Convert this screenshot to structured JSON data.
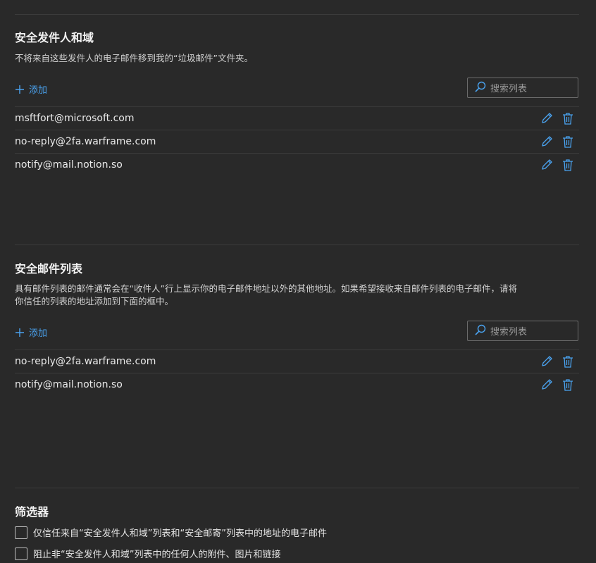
{
  "safe_senders": {
    "title": "安全发件人和域",
    "description": "不将来自这些发件人的电子邮件移到我的“垃圾邮件”文件夹。",
    "add_label": "添加",
    "search_placeholder": "搜索列表",
    "items": [
      "msftfort@microsoft.com",
      "no-reply@2fa.warframe.com",
      "notify@mail.notion.so"
    ]
  },
  "safe_mailing_lists": {
    "title": "安全邮件列表",
    "description_line1": "具有邮件列表的邮件通常会在“收件人”行上显示你的电子邮件地址以外的其他地址。如果希望接收来自邮件列表的电子邮件，请将",
    "description_line2": "你信任的列表的地址添加到下面的框中。",
    "add_label": "添加",
    "search_placeholder": "搜索列表",
    "items": [
      "no-reply@2fa.warframe.com",
      "notify@mail.notion.so"
    ]
  },
  "filters": {
    "title": "筛选器",
    "options": [
      {
        "label": "仅信任来自“安全发件人和域”列表和“安全邮寄”列表中的地址的电子邮件",
        "checked": false
      },
      {
        "label": "阻止非“安全发件人和域”列表中的任何人的附件、图片和链接",
        "checked": false
      }
    ]
  },
  "colors": {
    "accent": "#4aa3f0",
    "background": "#292929",
    "divider": "#3b3b3b"
  },
  "icons": {
    "add": "plus-icon",
    "search": "search-icon",
    "edit": "pencil-icon",
    "delete": "trash-icon"
  }
}
